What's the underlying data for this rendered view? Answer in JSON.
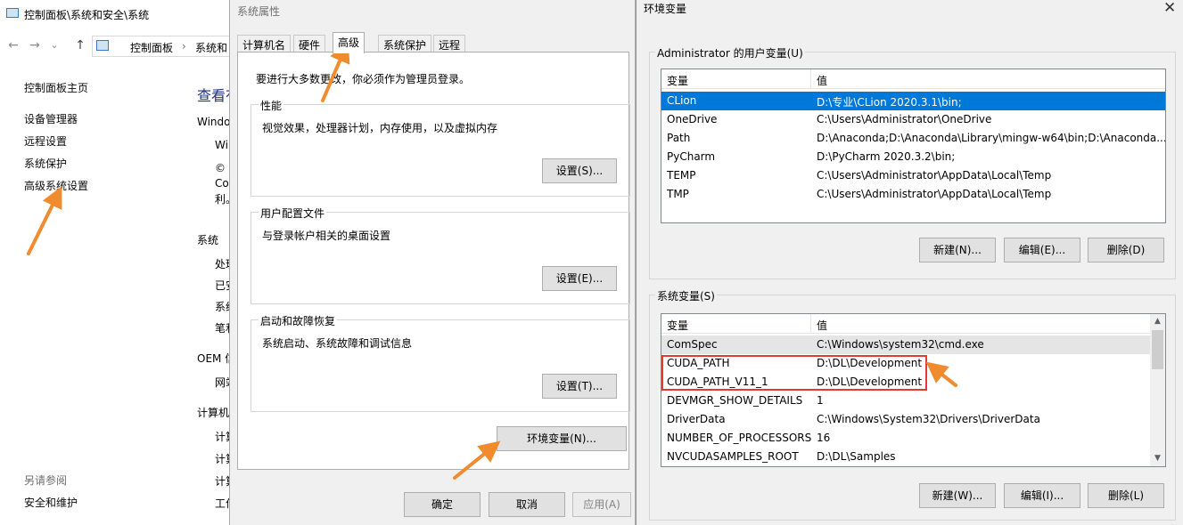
{
  "control_panel": {
    "title": "控制面板\\系统和安全\\系统",
    "nav": {
      "back": "←",
      "forward": "→",
      "dropdown": "⌄",
      "up": "↑"
    },
    "breadcrumb": [
      "控制面板",
      "系统和"
    ],
    "links": [
      "控制面板主页",
      "设备管理器",
      "远程设置",
      "系统保护",
      "高级系统设置"
    ],
    "see_also_title": "另请参阅",
    "see_also": [
      "安全和维护"
    ],
    "main_heading": "查看有",
    "right_fragments": [
      "Windo",
      "Wi",
      "©",
      "Co",
      "利。",
      "系统",
      "处理",
      "已安",
      "系统",
      "笔和",
      "OEM 信",
      "网站",
      "计算机",
      "计算",
      "计算",
      "计算",
      "工作"
    ]
  },
  "system_properties": {
    "title": "系统属性",
    "tabs": [
      "计算机名",
      "硬件",
      "高级",
      "系统保护",
      "远程"
    ],
    "active_tab": "高级",
    "admin_note": "要进行大多数更改，你必须作为管理员登录。",
    "groups": [
      {
        "title": "性能",
        "desc": "视觉效果，处理器计划，内存使用，以及虚拟内存",
        "button": "设置(S)..."
      },
      {
        "title": "用户配置文件",
        "desc": "与登录帐户相关的桌面设置",
        "button": "设置(E)..."
      },
      {
        "title": "启动和故障恢复",
        "desc": "系统启动、系统故障和调试信息",
        "button": "设置(T)..."
      }
    ],
    "env_button": "环境变量(N)...",
    "ok": "确定",
    "cancel": "取消",
    "apply": "应用(A)"
  },
  "env_vars": {
    "title": "环境变量",
    "close": "✕",
    "user_section_title": "Administrator 的用户变量(U)",
    "col_var": "变量",
    "col_val": "值",
    "user_vars": [
      {
        "name": "CLion",
        "value": "D:\\专业\\CLion 2020.3.1\\bin;"
      },
      {
        "name": "OneDrive",
        "value": "C:\\Users\\Administrator\\OneDrive"
      },
      {
        "name": "Path",
        "value": "D:\\Anaconda;D:\\Anaconda\\Library\\mingw-w64\\bin;D:\\Anaconda..."
      },
      {
        "name": "PyCharm",
        "value": "D:\\PyCharm 2020.3.2\\bin;"
      },
      {
        "name": "TEMP",
        "value": "C:\\Users\\Administrator\\AppData\\Local\\Temp"
      },
      {
        "name": "TMP",
        "value": "C:\\Users\\Administrator\\AppData\\Local\\Temp"
      }
    ],
    "user_buttons": [
      "新建(N)...",
      "编辑(E)...",
      "删除(D)"
    ],
    "system_section_title": "系统变量(S)",
    "system_vars": [
      {
        "name": "ComSpec",
        "value": "C:\\Windows\\system32\\cmd.exe"
      },
      {
        "name": "CUDA_PATH",
        "value": "D:\\DL\\Development"
      },
      {
        "name": "CUDA_PATH_V11_1",
        "value": "D:\\DL\\Development"
      },
      {
        "name": "DEVMGR_SHOW_DETAILS",
        "value": "1"
      },
      {
        "name": "DriverData",
        "value": "C:\\Windows\\System32\\Drivers\\DriverData"
      },
      {
        "name": "NUMBER_OF_PROCESSORS",
        "value": "16"
      },
      {
        "name": "NVCUDASAMPLES_ROOT",
        "value": "D:\\DL\\Samples"
      }
    ],
    "system_buttons": [
      "新建(W)...",
      "编辑(I)...",
      "删除(L)"
    ],
    "scroll_up": "▲",
    "scroll_down": "▼"
  },
  "colors": {
    "selection": "#0078d7",
    "annotation_arrow": "#f08c2e",
    "annotation_box": "#e53935"
  }
}
